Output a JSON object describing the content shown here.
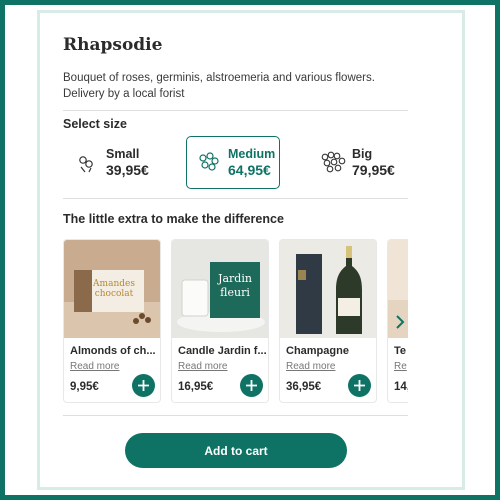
{
  "product": {
    "title": "Rhapsodie",
    "description": "Bouquet of roses, germinis, alstroemeria and various flowers.",
    "delivery": "Delivery by a local forist"
  },
  "size_section": {
    "title": "Select size",
    "options": [
      {
        "label": "Small",
        "price": "39,95€",
        "icon": "small-bouquet-icon",
        "selected": false
      },
      {
        "label": "Medium",
        "price": "64,95€",
        "icon": "medium-bouquet-icon",
        "selected": true
      },
      {
        "label": "Big",
        "price": "79,95€",
        "icon": "big-bouquet-icon",
        "selected": false
      }
    ]
  },
  "extras_section": {
    "title": "The little extra to make the difference",
    "items": [
      {
        "name": "Almonds of ch...",
        "link": "Read more",
        "price": "9,95€",
        "image_text": [
          "Amandes",
          "chocolat"
        ]
      },
      {
        "name": "Candle Jardin f...",
        "link": "Read more",
        "price": "16,95€",
        "image_text": [
          "Jardin",
          "fleuri"
        ]
      },
      {
        "name": "Champagne",
        "link": "Read more",
        "price": "36,95€"
      },
      {
        "name": "Te",
        "link": "Re",
        "price": "14,"
      }
    ]
  },
  "cart": {
    "label": "Add to cart"
  },
  "colors": {
    "accent": "#0e7364",
    "accent_light": "#d7ece6",
    "divider": "#dedede"
  }
}
